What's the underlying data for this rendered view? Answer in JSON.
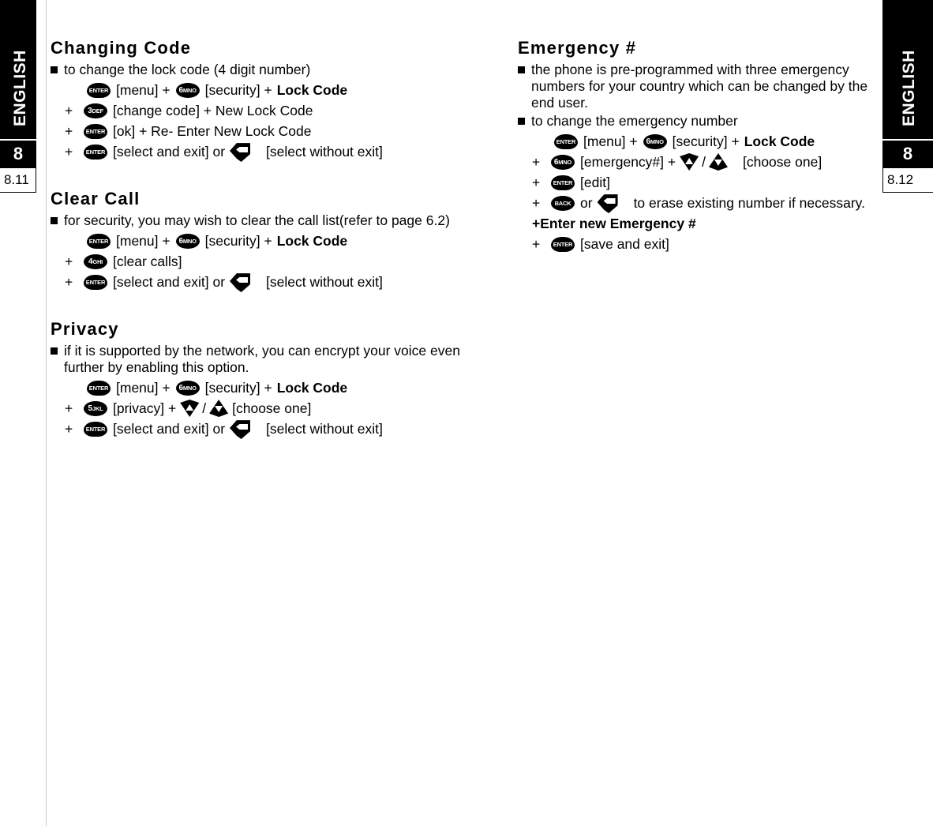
{
  "sidebar": {
    "language": "ENGLISH",
    "chapter": "8",
    "page_left": "8.11",
    "page_right": "8.12"
  },
  "keys": {
    "enter": "ENTER",
    "back": "BACK",
    "k3": "3",
    "k3sub": "DEF",
    "k4": "4",
    "k4sub": "GHI",
    "k5": "5",
    "k5sub": "JKL",
    "k6": "6",
    "k6sub": "MNO",
    "clr": "CLR",
    "nav_down": "nav-down",
    "nav_up": "nav-up"
  },
  "left_column": {
    "sections": [
      {
        "title": "Changing Code",
        "bullets": [
          "to change the lock code (4 digit number)"
        ],
        "steps": [
          {
            "plus": "",
            "key": "enter",
            "a": "[menu] +",
            "key2": "k6",
            "b": "[security] +",
            "bold": "Lock Code"
          },
          {
            "plus": "+",
            "key": "k3",
            "a": "[change code] + New Lock Code"
          },
          {
            "plus": "+",
            "key": "enter",
            "a": "[ok] + Re- Enter New Lock Code"
          },
          {
            "plus": "+",
            "key": "enter",
            "a": "[select and exit] or",
            "key2": "clr",
            "b": "[select without exit]"
          }
        ]
      },
      {
        "title": "Clear Call",
        "bullets": [
          "for security, you may wish to clear the call list(refer to page 6.2)"
        ],
        "steps": [
          {
            "plus": "",
            "key": "enter",
            "a": "[menu] +",
            "key2": "k6",
            "b": "[security] +",
            "bold": "Lock Code"
          },
          {
            "plus": "+",
            "key": "k4",
            "a": "[clear calls]"
          },
          {
            "plus": "+",
            "key": "enter",
            "a": "[select and exit] or",
            "key2": "clr",
            "b": "[select without exit]"
          }
        ]
      },
      {
        "title": "Privacy",
        "bullets": [
          "if it is supported by the network, you can encrypt your voice even further by enabling this option."
        ],
        "steps": [
          {
            "plus": "",
            "key": "enter",
            "a": "[menu] +",
            "key2": "k6",
            "b": "[security] +",
            "bold": "Lock Code"
          },
          {
            "plus": "+",
            "key": "k5",
            "a": "[privacy] +",
            "nav": true,
            "b": "[choose one]"
          },
          {
            "plus": "+",
            "key": "enter",
            "a": "[select and exit] or",
            "key2": "clr",
            "b": "[select without exit]"
          }
        ]
      }
    ]
  },
  "right_column": {
    "sections": [
      {
        "title": "Emergency #",
        "bullets": [
          "the phone is pre-programmed with three emergency numbers for your country which can be changed by the end user.",
          "to change the emergency number"
        ],
        "steps": [
          {
            "plus": "",
            "key": "enter",
            "a": "[menu] +",
            "key2": "k6",
            "b": "[security] +",
            "bold": "Lock Code"
          },
          {
            "plus": "+",
            "key": "k6",
            "a": "[emergency#] +",
            "nav": true,
            "b": "[choose one]"
          },
          {
            "plus": "+",
            "key": "enter",
            "a": "[edit]"
          },
          {
            "plus": "+",
            "key": "back",
            "a": "or",
            "key2": "clr",
            "b": "to erase existing number if necessary."
          },
          {
            "plus": "+",
            "boldline": "Enter new Emergency #"
          },
          {
            "plus": "+",
            "key": "enter",
            "a": "[save and exit]"
          }
        ]
      }
    ]
  }
}
